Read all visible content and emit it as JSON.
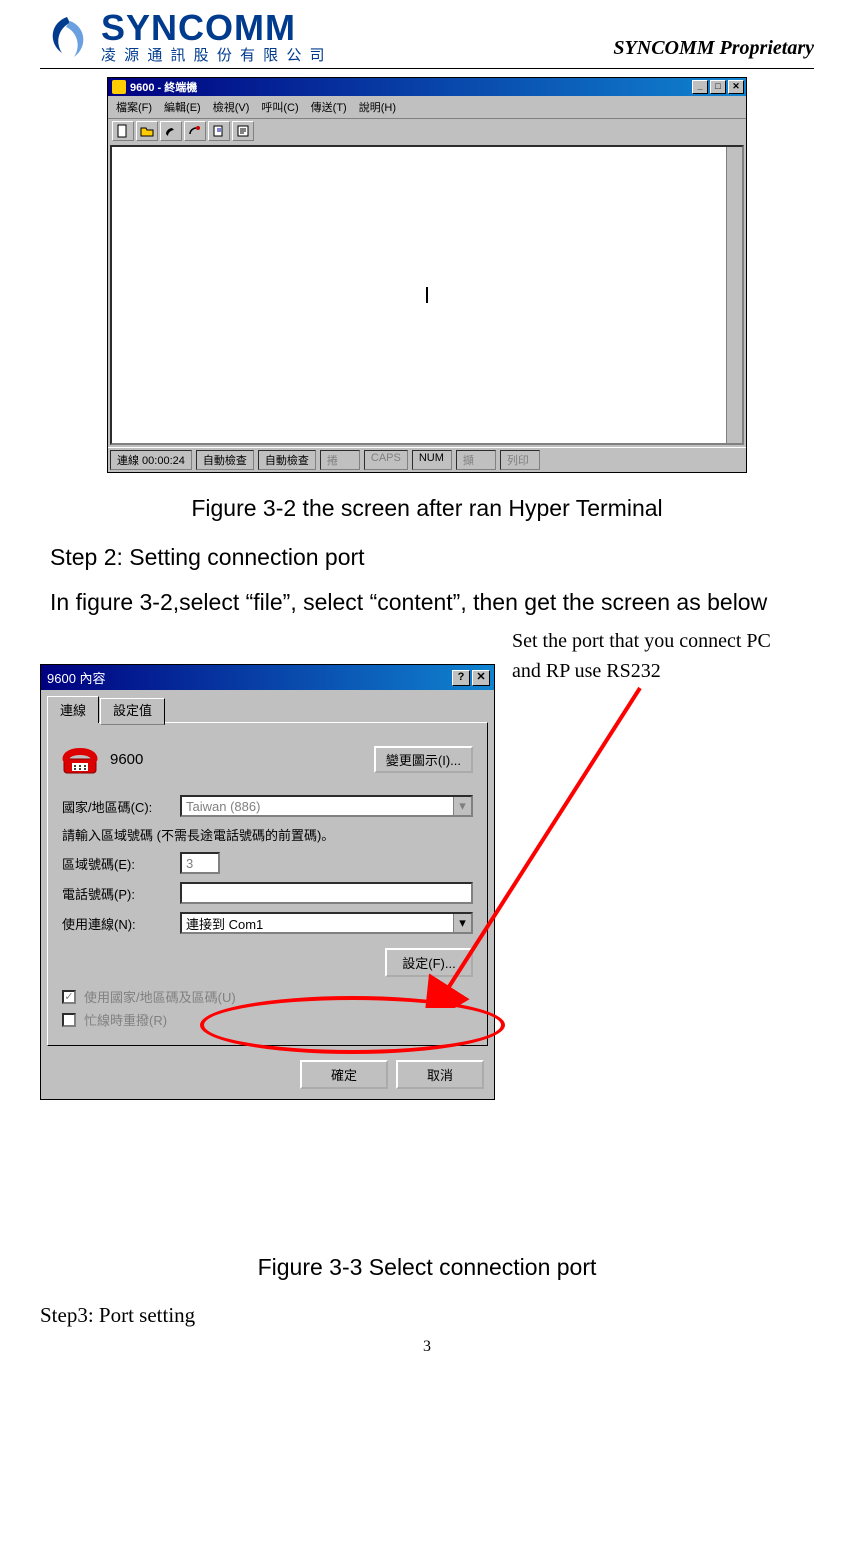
{
  "header": {
    "logo_text": "SYNCOMM",
    "logo_sub": "凌 源 通 訊 股 份 有 限 公 司",
    "proprietary": "SYNCOMM Proprietary"
  },
  "hyperterm": {
    "title": "9600 - 終端機",
    "menu": [
      "檔案(F)",
      "編輯(E)",
      "檢視(V)",
      "呼叫(C)",
      "傳送(T)",
      "說明(H)"
    ],
    "status": {
      "conn": "連線 00:00:24",
      "auto1": "自動檢查",
      "auto2": "自動檢查",
      "p1": "捲",
      "p2": "CAPS",
      "p3": "NUM",
      "p4": "擷",
      "p5": "列印"
    }
  },
  "figure32": "Figure 3-2 the screen after ran Hyper Terminal",
  "step2_title": "Step 2: Setting connection port",
  "step2_body": "In figure 3-2,select “file”, select “content”, then get the screen as below",
  "annotation_note": "Set the port that you connect PC and RP use RS232",
  "dialog": {
    "title": "9600 內容",
    "tab1": "連線",
    "tab2": "設定值",
    "conn_name": "9600",
    "change_icon": "變更圖示(I)...",
    "country_label": "國家/地區碼(C):",
    "country_value": "Taiwan (886)",
    "area_note": "請輸入區域號碼 (不需長途電話號碼的前置碼)。",
    "area_label": "區域號碼(E):",
    "area_value": "3",
    "phone_label": "電話號碼(P):",
    "phone_value": "",
    "connect_label": "使用連線(N):",
    "connect_value": "連接到 Com1",
    "settings_btn": "設定(F)...",
    "chk1": "使用國家/地區碼及區碼(U)",
    "chk2": "忙線時重撥(R)",
    "ok": "確定",
    "cancel": "取消"
  },
  "figure33": "Figure 3-3 Select connection port",
  "step3": "Step3: Port setting",
  "page_number": "3"
}
